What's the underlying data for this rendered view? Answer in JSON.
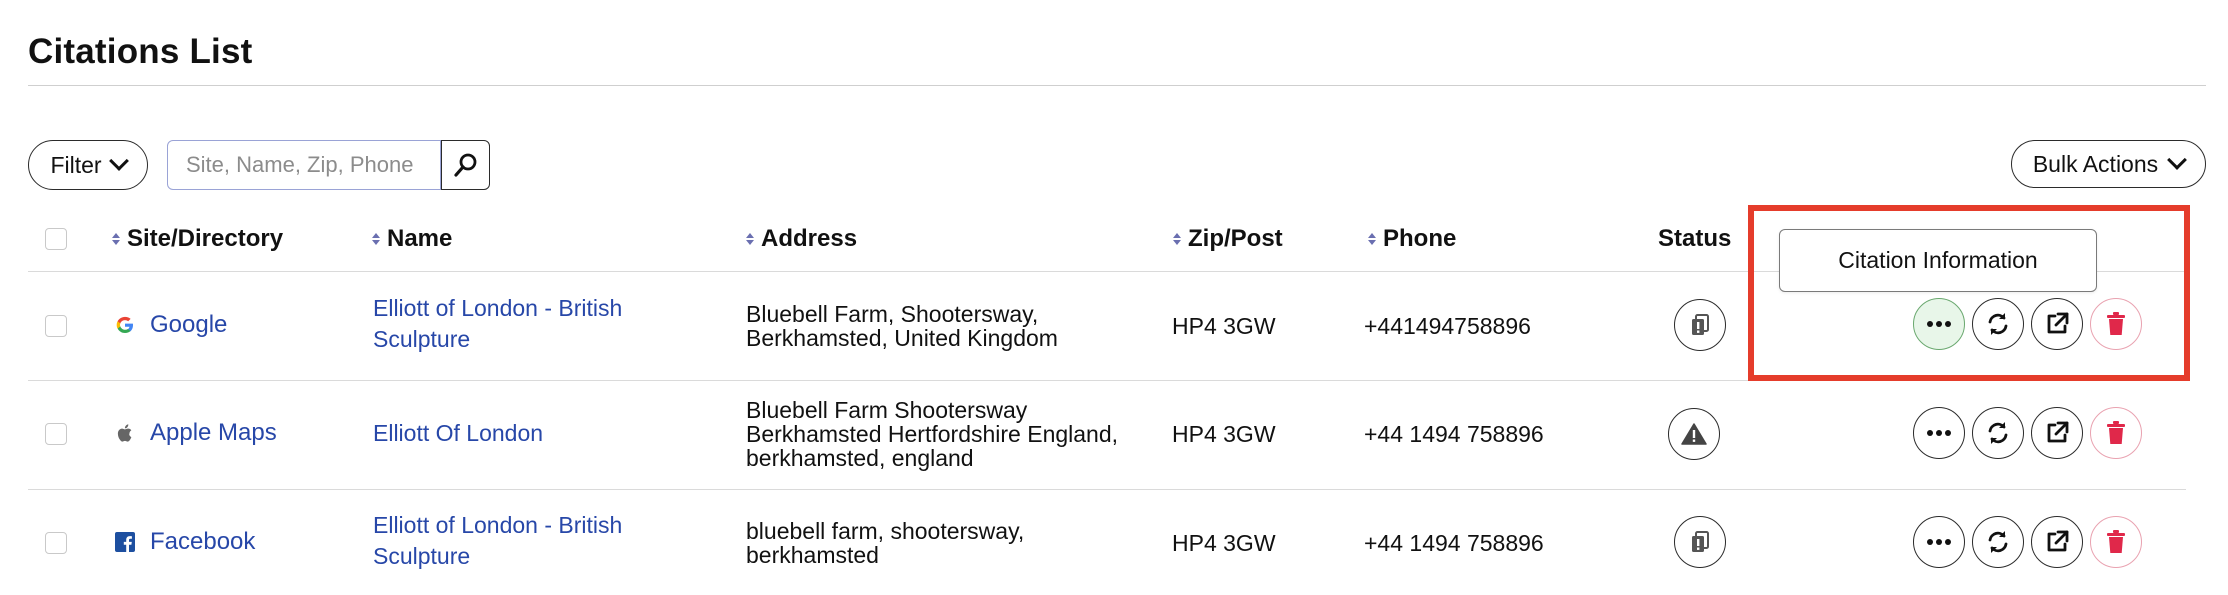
{
  "page": {
    "title": "Citations List"
  },
  "toolbar": {
    "filter_label": "Filter",
    "search_placeholder": "Site, Name, Zip, Phone",
    "search_value": "",
    "bulk_label": "Bulk Actions"
  },
  "table": {
    "columns": {
      "site": "Site/Directory",
      "name": "Name",
      "address": "Address",
      "zip": "Zip/Post",
      "phone": "Phone",
      "status": "Status"
    },
    "rows": [
      {
        "site": "Google",
        "site_icon": "google-icon",
        "name_line1": "Elliott of London - British",
        "name_line2": "Sculpture",
        "address_line1": "Bluebell Farm, Shootersway,",
        "address_line2": "Berkhamsted, United Kingdom",
        "address_line3": "",
        "zip": "HP4 3GW",
        "phone": "+441494758896",
        "status_icon": "pending-icon"
      },
      {
        "site": "Apple Maps",
        "site_icon": "apple-icon",
        "name_line1": "Elliott Of London",
        "name_line2": "",
        "address_line1": "Bluebell Farm Shootersway",
        "address_line2": "Berkhamsted Hertfordshire England,",
        "address_line3": "berkhamsted, england",
        "zip": "HP4 3GW",
        "phone": "+44 1494 758896",
        "status_icon": "warning-icon"
      },
      {
        "site": "Facebook",
        "site_icon": "facebook-icon",
        "name_line1": "Elliott of London - British",
        "name_line2": "Sculpture",
        "address_line1": "bluebell farm, shootersway,",
        "address_line2": "berkhamsted",
        "address_line3": "",
        "zip": "HP4 3GW",
        "phone": "+44 1494 758896",
        "status_icon": "pending-icon"
      }
    ]
  },
  "tooltip": {
    "text": "Citation Information"
  },
  "colors": {
    "link": "#2747a8",
    "highlight": "#e53c2b",
    "hover_bg": "#e8f6e9",
    "delete": "#e0284a"
  }
}
